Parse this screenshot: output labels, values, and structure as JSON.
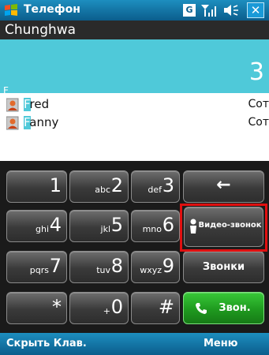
{
  "title_bar": {
    "title": "Телефон",
    "network_badge": "G",
    "close_label": "✕"
  },
  "operator": "Chunghwa",
  "display": {
    "number": "3",
    "letter": "F"
  },
  "contacts": [
    {
      "first_letter": "F",
      "rest": "red",
      "type": "Сот"
    },
    {
      "first_letter": "F",
      "rest": "anny",
      "type": "Сот"
    }
  ],
  "keypad": {
    "keys": [
      {
        "digit": "1",
        "letters": ""
      },
      {
        "digit": "2",
        "letters": "abc"
      },
      {
        "digit": "3",
        "letters": "def"
      },
      {
        "digit": "4",
        "letters": "ghi"
      },
      {
        "digit": "5",
        "letters": "jkl"
      },
      {
        "digit": "6",
        "letters": "mno"
      },
      {
        "digit": "7",
        "letters": "pqrs"
      },
      {
        "digit": "8",
        "letters": "tuv"
      },
      {
        "digit": "9",
        "letters": "wxyz"
      },
      {
        "digit": "*",
        "letters": ""
      },
      {
        "digit": "0",
        "letters": "+"
      },
      {
        "digit": "#",
        "letters": ""
      }
    ],
    "backspace": "←",
    "video_call": "Видео-звонок",
    "calls": "Звонки",
    "dial": "Звон."
  },
  "softkeys": {
    "left": "Скрыть Клав.",
    "right": "Меню"
  },
  "colors": {
    "accent": "#4fc9d9",
    "title_bar": "#0b5d8c",
    "highlight": "#e01010",
    "call_green": "#1f9a1f"
  }
}
